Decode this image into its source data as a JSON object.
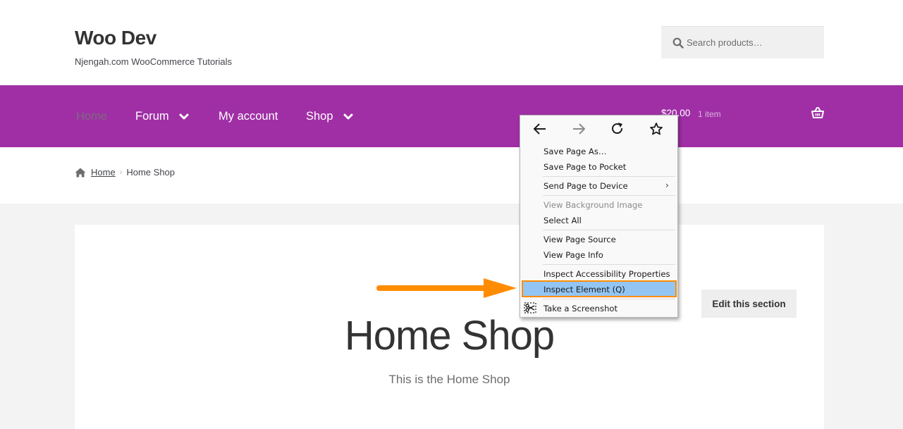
{
  "header": {
    "site_title": "Woo Dev",
    "tagline": "Njengah.com WooCommerce Tutorials",
    "search_placeholder": "Search products…"
  },
  "nav": {
    "items": [
      {
        "label": "Home",
        "active": true
      },
      {
        "label": "Forum",
        "has_dropdown": true
      },
      {
        "label": "My account"
      },
      {
        "label": "Shop",
        "has_dropdown": true
      }
    ],
    "cart_total": "$20.00",
    "cart_count": "1 item"
  },
  "breadcrumb": {
    "home": "Home",
    "current": "Home Shop"
  },
  "content": {
    "edit_button": "Edit this section",
    "heading": "Home Shop",
    "subtext": "This is the Home Shop"
  },
  "context_menu": {
    "nav_icons": [
      "back-icon",
      "forward-icon",
      "reload-icon",
      "bookmark-star-icon"
    ],
    "items": [
      {
        "label": "Save Page As…"
      },
      {
        "label": "Save Page to Pocket"
      },
      {
        "label": "Send Page to Device",
        "submenu": true
      },
      {
        "label": "View Background Image",
        "disabled": true
      },
      {
        "label": "Select All"
      },
      {
        "label": "View Page Source"
      },
      {
        "label": "View Page Info"
      },
      {
        "label": "Inspect Accessibility Properties"
      },
      {
        "label": "Inspect Element (Q)",
        "highlighted": true
      },
      {
        "label": "Take a Screenshot"
      }
    ]
  },
  "colors": {
    "nav_purple": "#a02fa6",
    "highlight_blue": "#93c5f4",
    "annotation_orange": "#ff8c00"
  }
}
